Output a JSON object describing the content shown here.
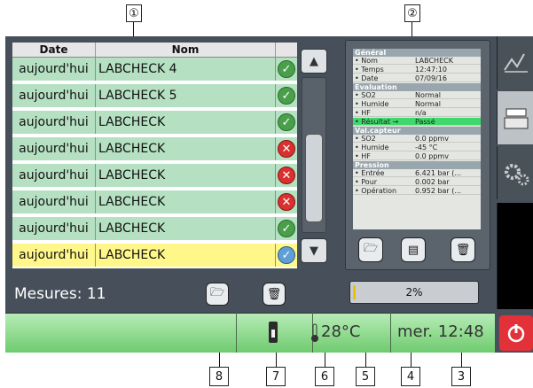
{
  "callouts": {
    "c1": "①",
    "c2": "②",
    "c3": "3",
    "c4": "4",
    "c5": "5",
    "c6": "6",
    "c7": "7",
    "c8": "8"
  },
  "table": {
    "headers": {
      "date": "Date",
      "nom": "Nom"
    },
    "rows": [
      {
        "date": "aujourd'hui",
        "nom": "LABCHECK 4",
        "status": "ok"
      },
      {
        "date": "aujourd'hui",
        "nom": "LABCHECK 5",
        "status": "ok"
      },
      {
        "date": "aujourd'hui",
        "nom": "LABCHECK",
        "status": "ok"
      },
      {
        "date": "aujourd'hui",
        "nom": "LABCHECK",
        "status": "fail"
      },
      {
        "date": "aujourd'hui",
        "nom": "LABCHECK",
        "status": "fail"
      },
      {
        "date": "aujourd'hui",
        "nom": "LABCHECK",
        "status": "fail"
      },
      {
        "date": "aujourd'hui",
        "nom": "LABCHECK",
        "status": "ok"
      },
      {
        "date": "aujourd'hui",
        "nom": "LABCHECK",
        "status": "ok",
        "selected": true
      }
    ]
  },
  "mesures_label": "Mesures: 11",
  "progress": {
    "text": "2%",
    "value": 0.02
  },
  "info": {
    "sections": [
      {
        "title": "Général",
        "rows": [
          [
            "• Nom",
            "LABCHECK"
          ],
          [
            "• Temps",
            "12:47:10"
          ],
          [
            "• Date",
            "07/09/16"
          ]
        ]
      },
      {
        "title": "Evaluation",
        "rows": [
          [
            "• SO2",
            "Normal"
          ],
          [
            "• Humide",
            "Normal"
          ],
          [
            "• HF",
            "n/a"
          ],
          [
            "• Résultat →",
            "Passé"
          ]
        ]
      },
      {
        "title": "Val.capteur",
        "rows": [
          [
            "• SO2",
            "0.0 ppmv"
          ],
          [
            "• Humide",
            "-45 °C"
          ],
          [
            "• HF",
            "0.0 ppmv"
          ]
        ]
      },
      {
        "title": "Pression",
        "rows": [
          [
            "• Entrée",
            "6.421 bar (..."
          ],
          [
            "• Pour",
            "0.002 bar"
          ],
          [
            "• Opération",
            "0.952 bar (..."
          ]
        ]
      }
    ]
  },
  "status": {
    "temperature": "28°C",
    "clock": "mer. 12:48"
  },
  "colors": {
    "row_ok": "#b5e1c2",
    "row_selected": "#fff78a",
    "result_highlight": "#3ed96a",
    "power": "#e3313a"
  }
}
